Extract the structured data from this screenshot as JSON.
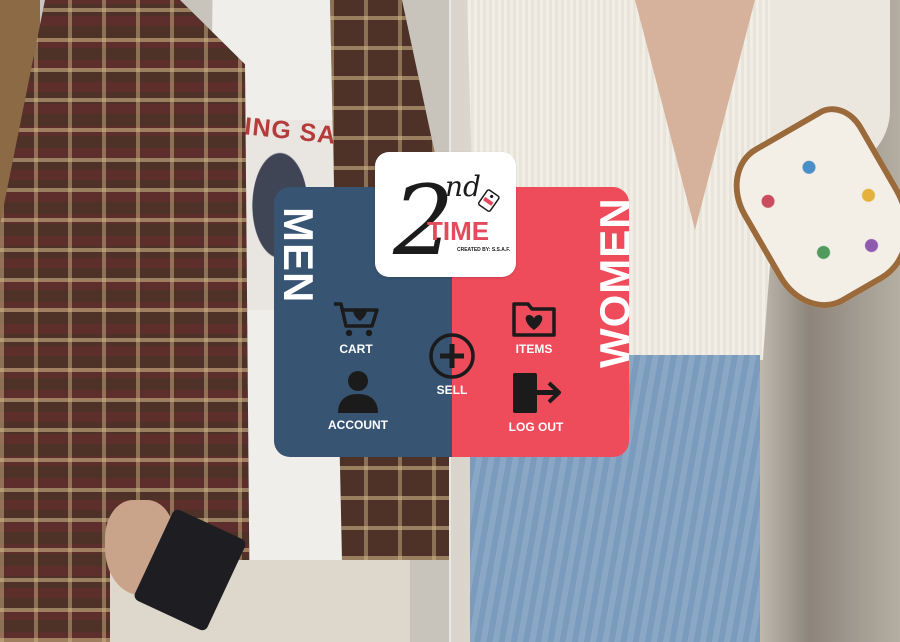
{
  "logo": {
    "numeral": "2",
    "superscript": "nd",
    "word": "TIME",
    "credit": "CREATED BY: S.S.A.F."
  },
  "sections": {
    "men": "MEN",
    "women": "WOMEN"
  },
  "menu": {
    "cart": "CART",
    "account": "ACCOUNT",
    "sell": "SELL",
    "items": "ITEMS",
    "logout": "LOG OUT"
  },
  "background": {
    "tee_print_text": "TING SALE"
  },
  "colors": {
    "men_panel": "#375473",
    "women_panel": "#ee4b5b",
    "logo_text": "#1b1b1b",
    "logo_accent": "#e34b5c"
  },
  "icons": [
    "cart-heart-icon",
    "account-person-icon",
    "sell-plus-icon",
    "items-folder-heart-icon",
    "logout-exit-icon"
  ]
}
